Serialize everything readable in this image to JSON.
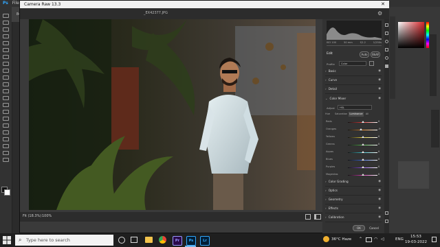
{
  "photoshop": {
    "menu": [
      "Ps",
      "File"
    ],
    "doc_tab": "84"
  },
  "camera_raw": {
    "title": "Camera Raw 13.3",
    "filename": "_EX42377.JPG",
    "zoom": "Fit (18.3%)",
    "zoom_pct": "100%",
    "camera_meta": [
      "ISO 100",
      "50 mm",
      "f/2.2",
      "1/250s"
    ],
    "edit_label": "Edit",
    "auto_label": "Auto",
    "bw_label": "B&W",
    "profile_label": "Profile",
    "profile_value": "Color",
    "sections_top": [
      "Basic",
      "Curve",
      "Detail"
    ],
    "color_mixer": {
      "title": "Color Mixer",
      "adjust_label": "Adjust",
      "adjust_value": "HSL",
      "tabs": [
        "Hue",
        "Saturation",
        "Luminance",
        "All"
      ],
      "sliders": [
        {
          "name": "Reds",
          "value": "0",
          "fraction": 0.5
        },
        {
          "name": "Oranges",
          "value": "-9",
          "fraction": 0.45
        },
        {
          "name": "Yellows",
          "value": "0",
          "fraction": 0.5
        },
        {
          "name": "Greens",
          "value": "0",
          "fraction": 0.5
        },
        {
          "name": "Aquas",
          "value": "0",
          "fraction": 0.5
        },
        {
          "name": "Blues",
          "value": "0",
          "fraction": 0.5
        },
        {
          "name": "Purples",
          "value": "0",
          "fraction": 0.5
        },
        {
          "name": "Magentas",
          "value": "0",
          "fraction": 0.5
        }
      ]
    },
    "sections_bottom": [
      "Color Grading",
      "Optics",
      "Geometry",
      "Effects",
      "Calibration"
    ],
    "ok_label": "OK",
    "cancel_label": "Cancel"
  },
  "taskbar": {
    "search_placeholder": "Type here to search",
    "weather": "36°C Haze",
    "language": "ENG",
    "time": "15:53",
    "date": "19-03-2022",
    "apps": [
      "Pr",
      "Ps",
      "Lr"
    ]
  },
  "colors": {
    "ps_blue": "#31a8ff",
    "pr_purple": "#9999ff",
    "lr_blue": "#31a8ff",
    "accent_red": "#d7272b"
  }
}
